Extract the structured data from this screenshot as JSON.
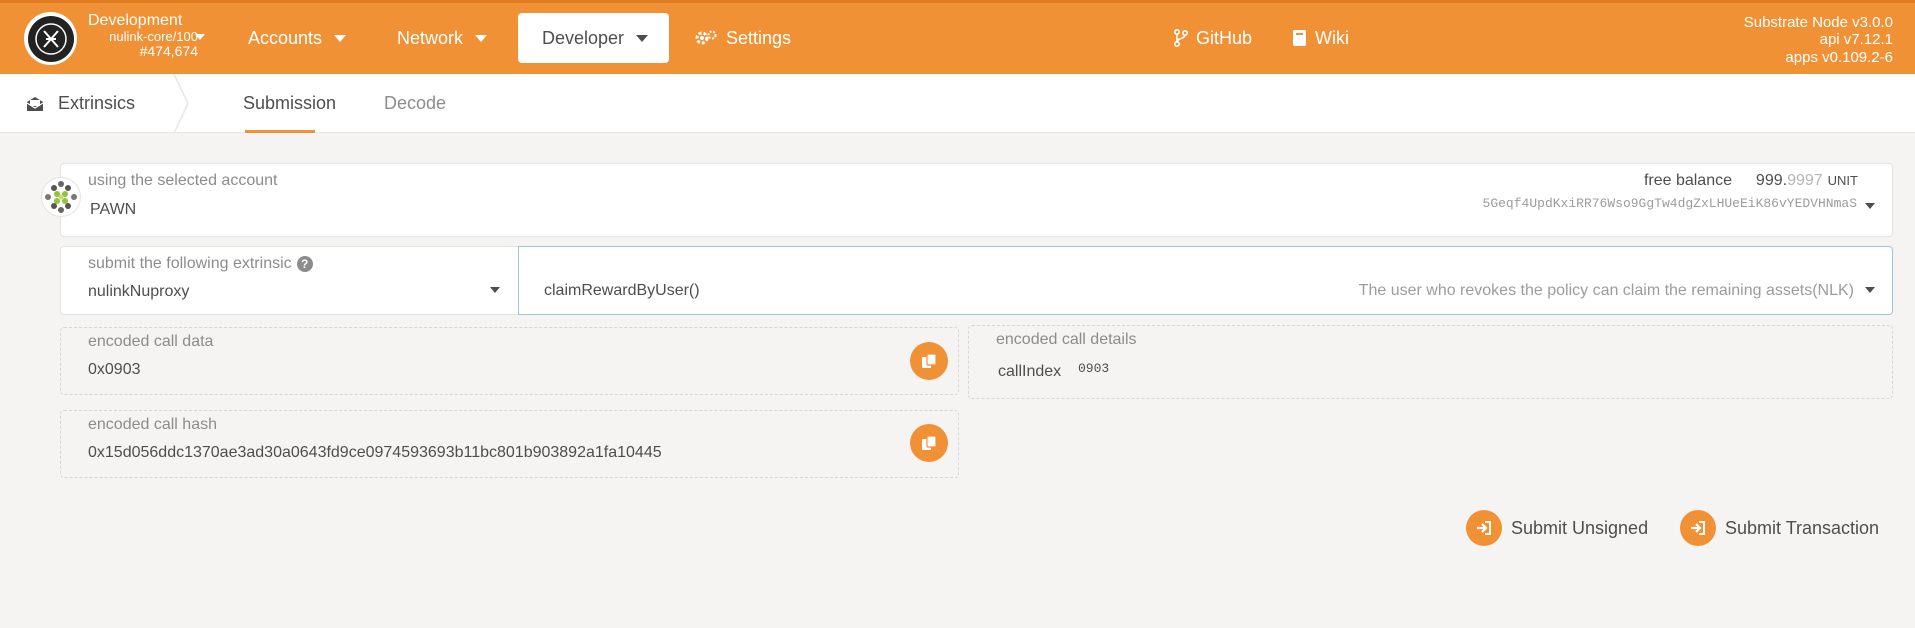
{
  "topbar": {
    "chain": {
      "name": "Development",
      "runtime": "nulink-core/100",
      "block": "#474,674"
    },
    "nav": [
      {
        "label": "Accounts",
        "has_caret": true
      },
      {
        "label": "Network",
        "has_caret": true
      },
      {
        "label": "Developer",
        "has_caret": true,
        "active": true
      },
      {
        "label": "Settings",
        "icon": "gears-icon"
      }
    ],
    "links": [
      {
        "label": "GitHub",
        "icon": "code-branch-icon"
      },
      {
        "label": "Wiki",
        "icon": "book-icon"
      }
    ],
    "node": {
      "name": "Substrate Node v3.0.0",
      "api": "api v7.12.1",
      "apps": "apps v0.109.2-6"
    },
    "accent_color": "#f19135"
  },
  "subnav": {
    "section": "Extrinsics",
    "tabs": [
      {
        "label": "Submission",
        "active": true
      },
      {
        "label": "Decode",
        "active": false
      }
    ]
  },
  "account": {
    "label": "using the selected account",
    "name": "PAWN",
    "balance_label": "free balance",
    "balance_int": "999.",
    "balance_dec": "9997",
    "balance_unit": "UNIT",
    "address": "5Geqf4UpdKxiRR76Wso9GgTw4dgZxLHUeEiK86vYEDVHNmaS"
  },
  "extrinsic": {
    "label": "submit the following extrinsic",
    "module": "nulinkNuproxy",
    "method": "claimRewardByUser()",
    "description": "The user who revokes the policy can claim the remaining assets(NLK)"
  },
  "encoded_call_data": {
    "label": "encoded call data",
    "value": "0x0903"
  },
  "encoded_call_details": {
    "label": "encoded call details",
    "field_label": "callIndex",
    "field_value": "0903"
  },
  "encoded_call_hash": {
    "label": "encoded call hash",
    "value": "0x15d056ddc1370ae3ad30a0643fd9ce0974593693b11bc801b903892a1fa10445"
  },
  "actions": {
    "submit_unsigned": "Submit Unsigned",
    "submit_transaction": "Submit Transaction"
  }
}
